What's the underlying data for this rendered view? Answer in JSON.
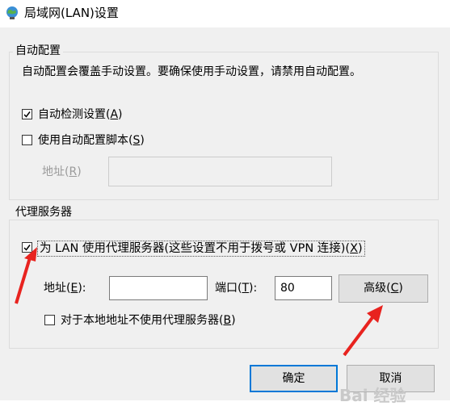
{
  "window": {
    "title": "局域网(LAN)设置",
    "icon": "globe-network-icon"
  },
  "auto_config": {
    "group_title": "自动配置",
    "description": "自动配置会覆盖手动设置。要确保使用手动设置，请禁用自动配置。",
    "detect": {
      "label": "自动检测设置(",
      "key": "A",
      "suffix": ")",
      "checked": true
    },
    "script": {
      "label": "使用自动配置脚本(",
      "key": "S",
      "suffix": ")",
      "checked": false
    },
    "address": {
      "label": "地址(",
      "key": "R",
      "suffix": ")",
      "value": ""
    }
  },
  "proxy": {
    "group_title": "代理服务器",
    "use_proxy": {
      "label": "为 LAN 使用代理服务器(这些设置不用于拨号或 VPN 连接)(",
      "key": "X",
      "suffix": ")",
      "checked": true
    },
    "address": {
      "label": "地址(",
      "key": "E",
      "suffix": "):",
      "value": ""
    },
    "port": {
      "label": "端口(",
      "key": "T",
      "suffix": "):",
      "value": "80"
    },
    "advanced": {
      "label": "高级(",
      "key": "C",
      "suffix": ")"
    },
    "bypass_local": {
      "label": "对于本地地址不使用代理服务器(",
      "key": "B",
      "suffix": ")",
      "checked": false
    }
  },
  "buttons": {
    "ok": "确定",
    "cancel": "取消"
  },
  "watermark": "Bai 经验",
  "colors": {
    "arrow": "#e8231f",
    "accent": "#0078d7"
  }
}
